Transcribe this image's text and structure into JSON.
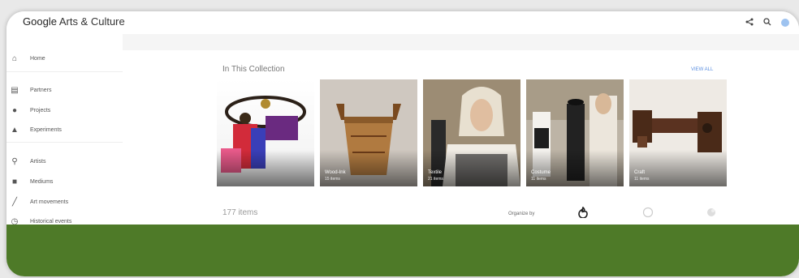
{
  "app": {
    "logo_google": "Google",
    "logo_suffix": "Arts & Culture"
  },
  "topbar": {
    "share_icon": "share-icon",
    "search_icon": "search-icon"
  },
  "sidebar": {
    "items": [
      {
        "label": "Home",
        "icon": "home-icon"
      },
      {
        "label": "Partners",
        "icon": "building-icon"
      },
      {
        "label": "Projects",
        "icon": "eye-icon"
      },
      {
        "label": "Experiments",
        "icon": "flask-icon"
      },
      {
        "label": "Artists",
        "icon": "person-icon"
      },
      {
        "label": "Mediums",
        "icon": "palette-icon"
      },
      {
        "label": "Art movements",
        "icon": "brush-icon"
      },
      {
        "label": "Historical events",
        "icon": "clock-icon"
      }
    ]
  },
  "collection": {
    "title": "In This Collection",
    "view_all": "VIEW ALL",
    "cards": [
      {
        "title": "",
        "subtitle": ""
      },
      {
        "title": "Wood-Ink",
        "subtitle": "15 items"
      },
      {
        "title": "Textile",
        "subtitle": "21 items"
      },
      {
        "title": "Costume",
        "subtitle": "11 items"
      },
      {
        "title": "Craft",
        "subtitle": "11 items"
      }
    ],
    "items_count": "177 items",
    "organize_label": "Organize by"
  },
  "colors": {
    "accent_green": "#4e7a28",
    "link_blue": "#5b8fe0"
  }
}
